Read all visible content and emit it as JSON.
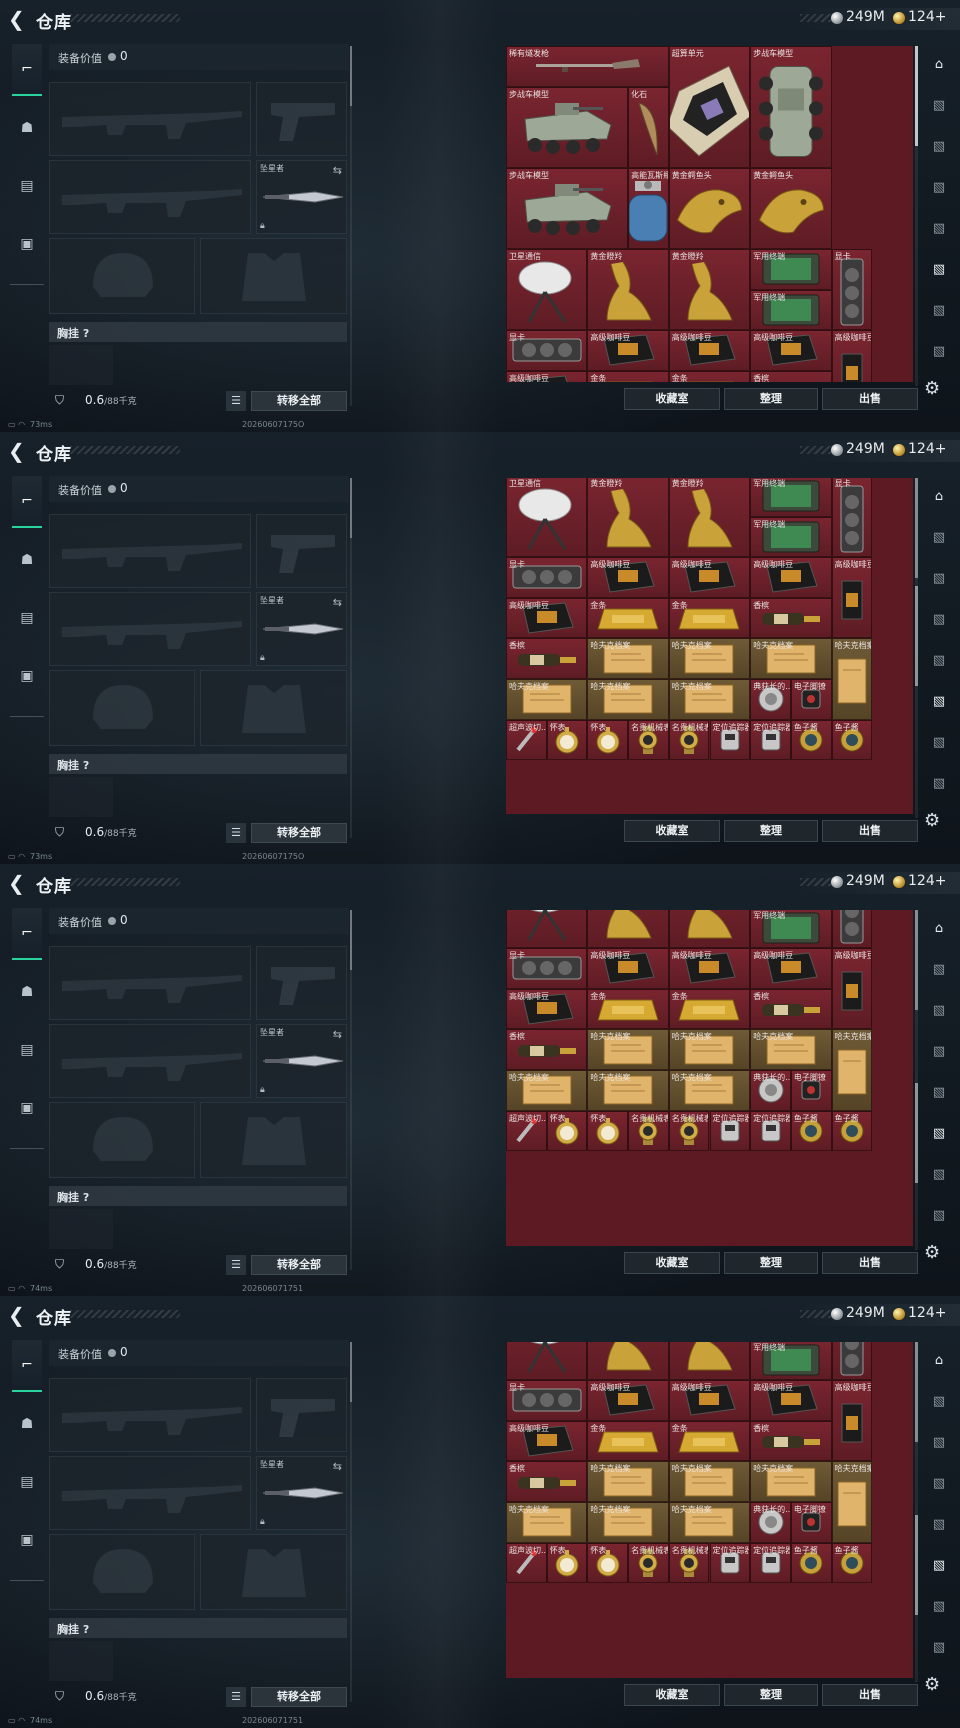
{
  "header": {
    "title": "仓库",
    "silver_amount": "249M",
    "gold_amount": "124+"
  },
  "equipment": {
    "value_label": "装备价值",
    "value": "0",
    "melee_label": "坠星者",
    "chest_rig_label": "胸挂 ?",
    "weight_current": "0.6",
    "weight_capacity": "/88千克",
    "transfer_all": "转移全部"
  },
  "warehouse_buttons": {
    "collection": "收藏室",
    "sort": "整理",
    "sell": "出售"
  },
  "left_tabs": [
    {
      "icon": "gun-icon"
    },
    {
      "icon": "helmet-icon"
    },
    {
      "icon": "clipboard-icon"
    },
    {
      "icon": "briefcase-icon"
    }
  ],
  "frames": [
    {
      "scroll": 0,
      "ping": "73ms",
      "timestamp": "20260607175O",
      "scroll_thumb": 0.0
    },
    {
      "scroll": 205,
      "ping": "73ms",
      "timestamp": "20260607175O",
      "scroll_thumb": 0.45
    },
    {
      "scroll": 246,
      "ping": "74ms",
      "timestamp": "202606071751",
      "scroll_thumb": 0.72
    },
    {
      "scroll": 246,
      "ping": "74ms",
      "timestamp": "202606071751",
      "scroll_thumb": 0.72
    }
  ],
  "items": [
    {
      "label": "稀有燧发枪",
      "icon": "musket",
      "bg": "red"
    },
    {
      "label": "超算单元",
      "icon": "server-board",
      "bg": "red"
    },
    {
      "label": "步战车模型",
      "icon": "apc-vertical",
      "bg": "red"
    },
    {
      "label": "步战车模型",
      "icon": "apc",
      "bg": "red"
    },
    {
      "label": "化石",
      "icon": "fossil-tooth",
      "bg": "red"
    },
    {
      "label": "步战车模型",
      "icon": "apc",
      "bg": "red"
    },
    {
      "label": "高能瓦斯瓶",
      "icon": "gas-canister",
      "bg": "red"
    },
    {
      "label": "黄金鳄鱼头",
      "icon": "gold-croc",
      "bg": "red"
    },
    {
      "label": "黄金鳄鱼头",
      "icon": "gold-croc",
      "bg": "red"
    },
    {
      "label": "卫星通信",
      "icon": "satellite-dish",
      "bg": "red"
    },
    {
      "label": "黄金瞪羚",
      "icon": "gold-gazelle",
      "bg": "red"
    },
    {
      "label": "黄金瞪羚",
      "icon": "gold-gazelle",
      "bg": "red"
    },
    {
      "label": "军用终端",
      "icon": "military-terminal",
      "bg": "red"
    },
    {
      "label": "军用终端",
      "icon": "military-terminal",
      "bg": "red"
    },
    {
      "label": "显卡",
      "icon": "gpu-vertical",
      "bg": "red"
    },
    {
      "label": "显卡",
      "icon": "gpu",
      "bg": "red"
    },
    {
      "label": "高级咖啡豆",
      "icon": "coffee-bag",
      "bg": "red"
    },
    {
      "label": "高级咖啡豆",
      "icon": "coffee-bag",
      "bg": "red"
    },
    {
      "label": "高级咖啡豆",
      "icon": "coffee-bag",
      "bg": "red"
    },
    {
      "label": "高级咖啡豆",
      "icon": "coffee-bag-vertical",
      "bg": "red"
    },
    {
      "label": "高级咖啡豆",
      "icon": "coffee-bag",
      "bg": "red"
    },
    {
      "label": "金条",
      "icon": "gold-bar",
      "bg": "red"
    },
    {
      "label": "金条",
      "icon": "gold-bar",
      "bg": "red"
    },
    {
      "label": "香槟",
      "icon": "champagne",
      "bg": "red"
    },
    {
      "label": "香槟",
      "icon": "champagne",
      "bg": "red"
    },
    {
      "label": "哈夫克档案",
      "icon": "archive-file",
      "bg": "gold"
    },
    {
      "label": "哈夫克档案",
      "icon": "archive-file",
      "bg": "gold"
    },
    {
      "label": "哈夫克档案",
      "icon": "archive-file",
      "bg": "gold"
    },
    {
      "label": "哈夫克档案",
      "icon": "archive-file-vertical",
      "bg": "gold"
    },
    {
      "label": "哈夫克档案",
      "icon": "archive-file",
      "bg": "gold"
    },
    {
      "label": "哈夫克档案",
      "icon": "archive-file",
      "bg": "gold"
    },
    {
      "label": "哈夫克档案",
      "icon": "archive-file",
      "bg": "gold"
    },
    {
      "label": "典获长的...",
      "icon": "medal",
      "bg": "red"
    },
    {
      "label": "电子脚镣",
      "icon": "ankle-monitor",
      "bg": "red"
    },
    {
      "label": "超声波切...",
      "icon": "ultrasonic-cutter",
      "bg": "red"
    },
    {
      "label": "怀表",
      "icon": "pocket-watch",
      "bg": "red"
    },
    {
      "label": "怀表",
      "icon": "pocket-watch",
      "bg": "red"
    },
    {
      "label": "名贵机械表",
      "icon": "wristwatch",
      "bg": "red"
    },
    {
      "label": "名贵机械表",
      "icon": "wristwatch",
      "bg": "red"
    },
    {
      "label": "定位追踪器",
      "icon": "gps-tracker",
      "bg": "red"
    },
    {
      "label": "定位追踪器",
      "icon": "gps-tracker",
      "bg": "red"
    },
    {
      "label": "鱼子酱",
      "icon": "caviar-tin",
      "bg": "red"
    },
    {
      "label": "鱼子酱",
      "icon": "caviar-tin",
      "bg": "red"
    }
  ],
  "right_tabs": [
    {
      "icon": "vault-icon"
    },
    {
      "icon": "storage-icon-1"
    },
    {
      "icon": "storage-icon-2"
    },
    {
      "icon": "storage-icon-3"
    },
    {
      "icon": "storage-icon-4"
    },
    {
      "icon": "storage-icon-5"
    },
    {
      "icon": "storage-icon-6"
    },
    {
      "icon": "storage-icon-7"
    }
  ]
}
